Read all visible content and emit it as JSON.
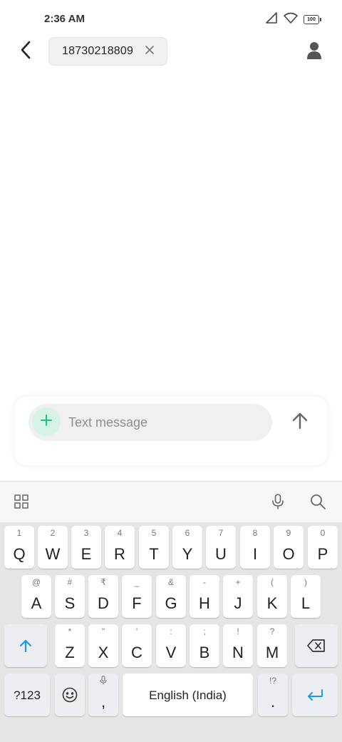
{
  "status_bar": {
    "time": "2:36 AM",
    "battery": "100",
    "icons": [
      "signal-icon",
      "wifi-icon",
      "battery-icon"
    ]
  },
  "header": {
    "recipient": "18730218809",
    "icons": [
      "back-arrow-icon",
      "close-icon",
      "contact-person-icon"
    ]
  },
  "compose": {
    "placeholder": "Text message",
    "value": "",
    "icons": [
      "plus-icon",
      "send-arrow-icon"
    ]
  },
  "keyboard": {
    "toolbar_icons": [
      "grid-icon",
      "microphone-icon",
      "search-icon"
    ],
    "row1": [
      {
        "hint": "1",
        "label": "Q"
      },
      {
        "hint": "2",
        "label": "W"
      },
      {
        "hint": "3",
        "label": "E"
      },
      {
        "hint": "4",
        "label": "R"
      },
      {
        "hint": "5",
        "label": "T"
      },
      {
        "hint": "6",
        "label": "Y"
      },
      {
        "hint": "7",
        "label": "U"
      },
      {
        "hint": "8",
        "label": "I"
      },
      {
        "hint": "9",
        "label": "O"
      },
      {
        "hint": "0",
        "label": "P"
      }
    ],
    "row2": [
      {
        "hint": "@",
        "label": "A"
      },
      {
        "hint": "#",
        "label": "S"
      },
      {
        "hint": "₹",
        "label": "D"
      },
      {
        "hint": "_",
        "label": "F"
      },
      {
        "hint": "&",
        "label": "G"
      },
      {
        "hint": "-",
        "label": "H"
      },
      {
        "hint": "+",
        "label": "J"
      },
      {
        "hint": "(",
        "label": "K"
      },
      {
        "hint": ")",
        "label": "L"
      }
    ],
    "row3": [
      {
        "hint": "*",
        "label": "Z"
      },
      {
        "hint": "\"",
        "label": "X"
      },
      {
        "hint": "'",
        "label": "C"
      },
      {
        "hint": ":",
        "label": "V"
      },
      {
        "hint": ";",
        "label": "B"
      },
      {
        "hint": "!",
        "label": "N"
      },
      {
        "hint": "?",
        "label": "M"
      }
    ],
    "symbols_label": "?123",
    "comma_label": ",",
    "space_label": "English (India)",
    "period_hint": "!?",
    "period_label": ".",
    "accent_color": "#1a9be6"
  }
}
